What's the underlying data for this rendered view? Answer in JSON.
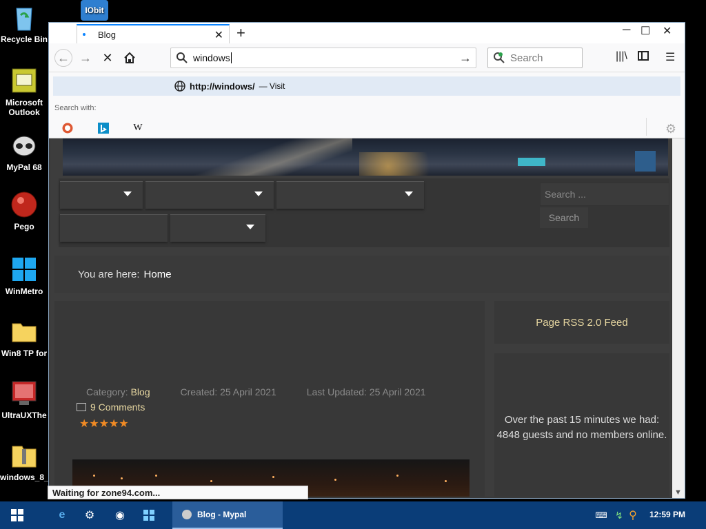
{
  "desktop": {
    "icons": [
      {
        "label": "Recycle Bin",
        "icon": "recycle-bin-icon"
      },
      {
        "label": "Microsoft Outlook",
        "icon": "outlook-icon"
      },
      {
        "label": "MyPal 68",
        "icon": "mypal-icon"
      },
      {
        "label": "Pego",
        "icon": "pego-icon"
      },
      {
        "label": "WinMetro",
        "icon": "winmetro-icon"
      },
      {
        "label": "Win8 TP for",
        "icon": "folder-icon"
      },
      {
        "label": "UltraUXThe",
        "icon": "ultraux-icon"
      },
      {
        "label": "windows_8_",
        "icon": "zip-folder-icon"
      }
    ],
    "top_icon_label": "IObit"
  },
  "browser": {
    "tab_title": "Blog",
    "new_tab": "+",
    "url_value": "windows",
    "search_placeholder": "Search",
    "suggestion_url": "http://windows/",
    "suggestion_action": "— Visit",
    "search_with_label": "Search with:",
    "status_text": "Waiting for zone94.com..."
  },
  "page": {
    "site_search_placeholder": "Search ...",
    "site_search_button": "Search",
    "breadcrumb_prefix": "You are here:",
    "breadcrumb_home": "Home",
    "category_label": "Category:",
    "category_value": "Blog",
    "created": "Created: 25 April 2021",
    "updated": "Last Updated: 25 April 2021",
    "comments": "9 Comments",
    "rating_stars": "★★★★★",
    "rss": "Page RSS 2.0 Feed",
    "visitors_line1": "Over the past 15 minutes we had:",
    "visitors_line2": "4848 guests and no members online."
  },
  "taskbar": {
    "active_window": "Blog - Mypal",
    "clock": "12:59 PM"
  },
  "colors": {
    "accent": "#0a84ff",
    "taskbar": "#0a3d78",
    "link_gold": "#e7d7a1",
    "star": "#f08a24"
  }
}
